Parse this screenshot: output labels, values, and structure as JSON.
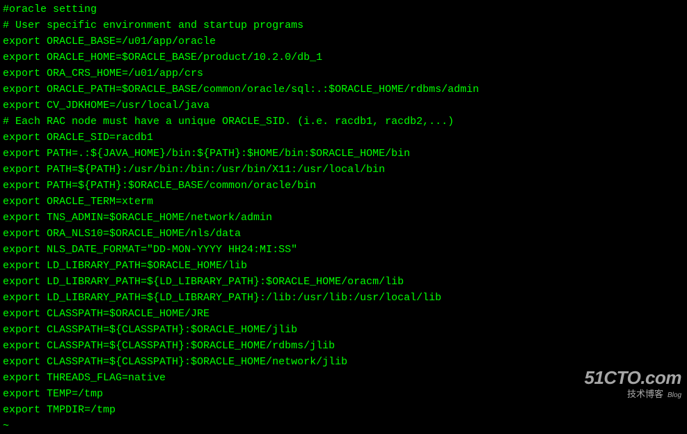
{
  "terminal": {
    "lines": [
      "#oracle setting",
      "# User specific environment and startup programs",
      "export ORACLE_BASE=/u01/app/oracle",
      "export ORACLE_HOME=$ORACLE_BASE/product/10.2.0/db_1",
      "export ORA_CRS_HOME=/u01/app/crs",
      "export ORACLE_PATH=$ORACLE_BASE/common/oracle/sql:.:$ORACLE_HOME/rdbms/admin",
      "export CV_JDKHOME=/usr/local/java",
      "# Each RAC node must have a unique ORACLE_SID. (i.e. racdb1, racdb2,...)",
      "export ORACLE_SID=racdb1",
      "export PATH=.:${JAVA_HOME}/bin:${PATH}:$HOME/bin:$ORACLE_HOME/bin",
      "export PATH=${PATH}:/usr/bin:/bin:/usr/bin/X11:/usr/local/bin",
      "export PATH=${PATH}:$ORACLE_BASE/common/oracle/bin",
      "export ORACLE_TERM=xterm",
      "export TNS_ADMIN=$ORACLE_HOME/network/admin",
      "export ORA_NLS10=$ORACLE_HOME/nls/data",
      "export NLS_DATE_FORMAT=\"DD-MON-YYYY HH24:MI:SS\"",
      "export LD_LIBRARY_PATH=$ORACLE_HOME/lib",
      "export LD_LIBRARY_PATH=${LD_LIBRARY_PATH}:$ORACLE_HOME/oracm/lib",
      "export LD_LIBRARY_PATH=${LD_LIBRARY_PATH}:/lib:/usr/lib:/usr/local/lib",
      "export CLASSPATH=$ORACLE_HOME/JRE",
      "export CLASSPATH=${CLASSPATH}:$ORACLE_HOME/jlib",
      "export CLASSPATH=${CLASSPATH}:$ORACLE_HOME/rdbms/jlib",
      "export CLASSPATH=${CLASSPATH}:$ORACLE_HOME/network/jlib",
      "export THREADS_FLAG=native",
      "export TEMP=/tmp",
      "export TMPDIR=/tmp",
      "~"
    ]
  },
  "watermark": {
    "main": "51CTO.com",
    "sub_cn": "技术博客",
    "sub_en": "Blog"
  }
}
